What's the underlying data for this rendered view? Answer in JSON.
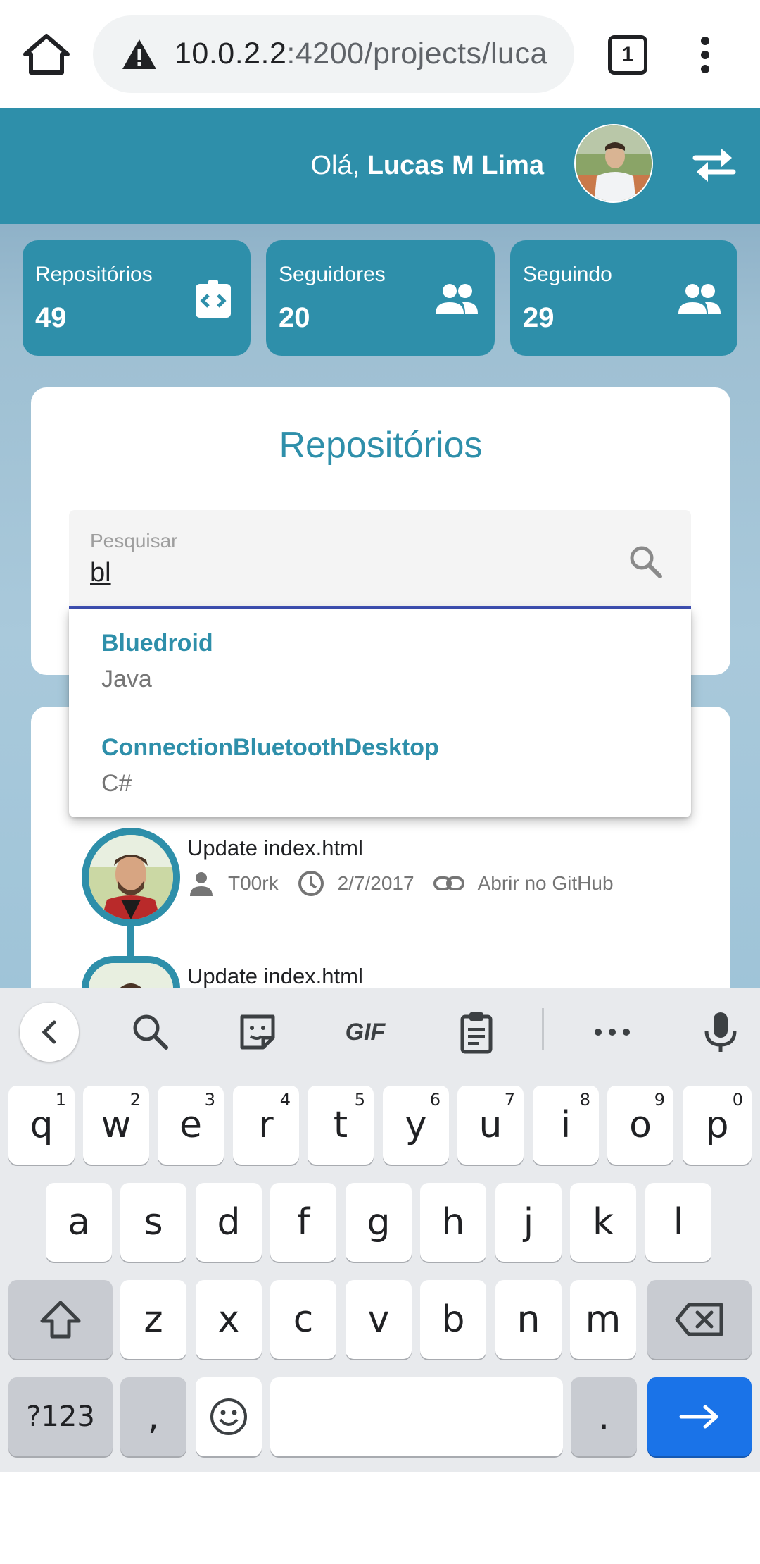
{
  "browser": {
    "url_host": "10.0.2.2",
    "url_rest": ":4200/projects/luca",
    "tab_count": "1"
  },
  "header": {
    "greeting": "Olá,",
    "user_name": "Lucas M Lima"
  },
  "stats": [
    {
      "label": "Repositórios",
      "value": "49",
      "icon": "code-repo-icon"
    },
    {
      "label": "Seguidores",
      "value": "20",
      "icon": "people-icon"
    },
    {
      "label": "Seguindo",
      "value": "29",
      "icon": "people-icon"
    }
  ],
  "repos_card": {
    "title": "Repositórios",
    "search_label": "Pesquisar",
    "search_value": "bl"
  },
  "suggestions": [
    {
      "name": "Bluedroid",
      "language": "Java"
    },
    {
      "name": "ConnectionBluetoothDesktop",
      "language": "C#"
    }
  ],
  "commits": [
    {
      "message": "Update index.html",
      "author": "T00rk",
      "date": "2/7/2017",
      "link": "Abrir no GitHub"
    },
    {
      "message": "Update index.html"
    }
  ],
  "keyboard": {
    "row1": [
      "q",
      "w",
      "e",
      "r",
      "t",
      "y",
      "u",
      "i",
      "o",
      "p"
    ],
    "row1_nums": [
      "1",
      "2",
      "3",
      "4",
      "5",
      "6",
      "7",
      "8",
      "9",
      "0"
    ],
    "row2": [
      "a",
      "s",
      "d",
      "f",
      "g",
      "h",
      "j",
      "k",
      "l"
    ],
    "row3": [
      "z",
      "x",
      "c",
      "v",
      "b",
      "n",
      "m"
    ],
    "symbols_label": "?123",
    "comma": ",",
    "period": ".",
    "gif_label": "GIF"
  },
  "colors": {
    "primary": "#2e8faa",
    "underline": "#3f51b5",
    "enter_key": "#1a73e8"
  }
}
